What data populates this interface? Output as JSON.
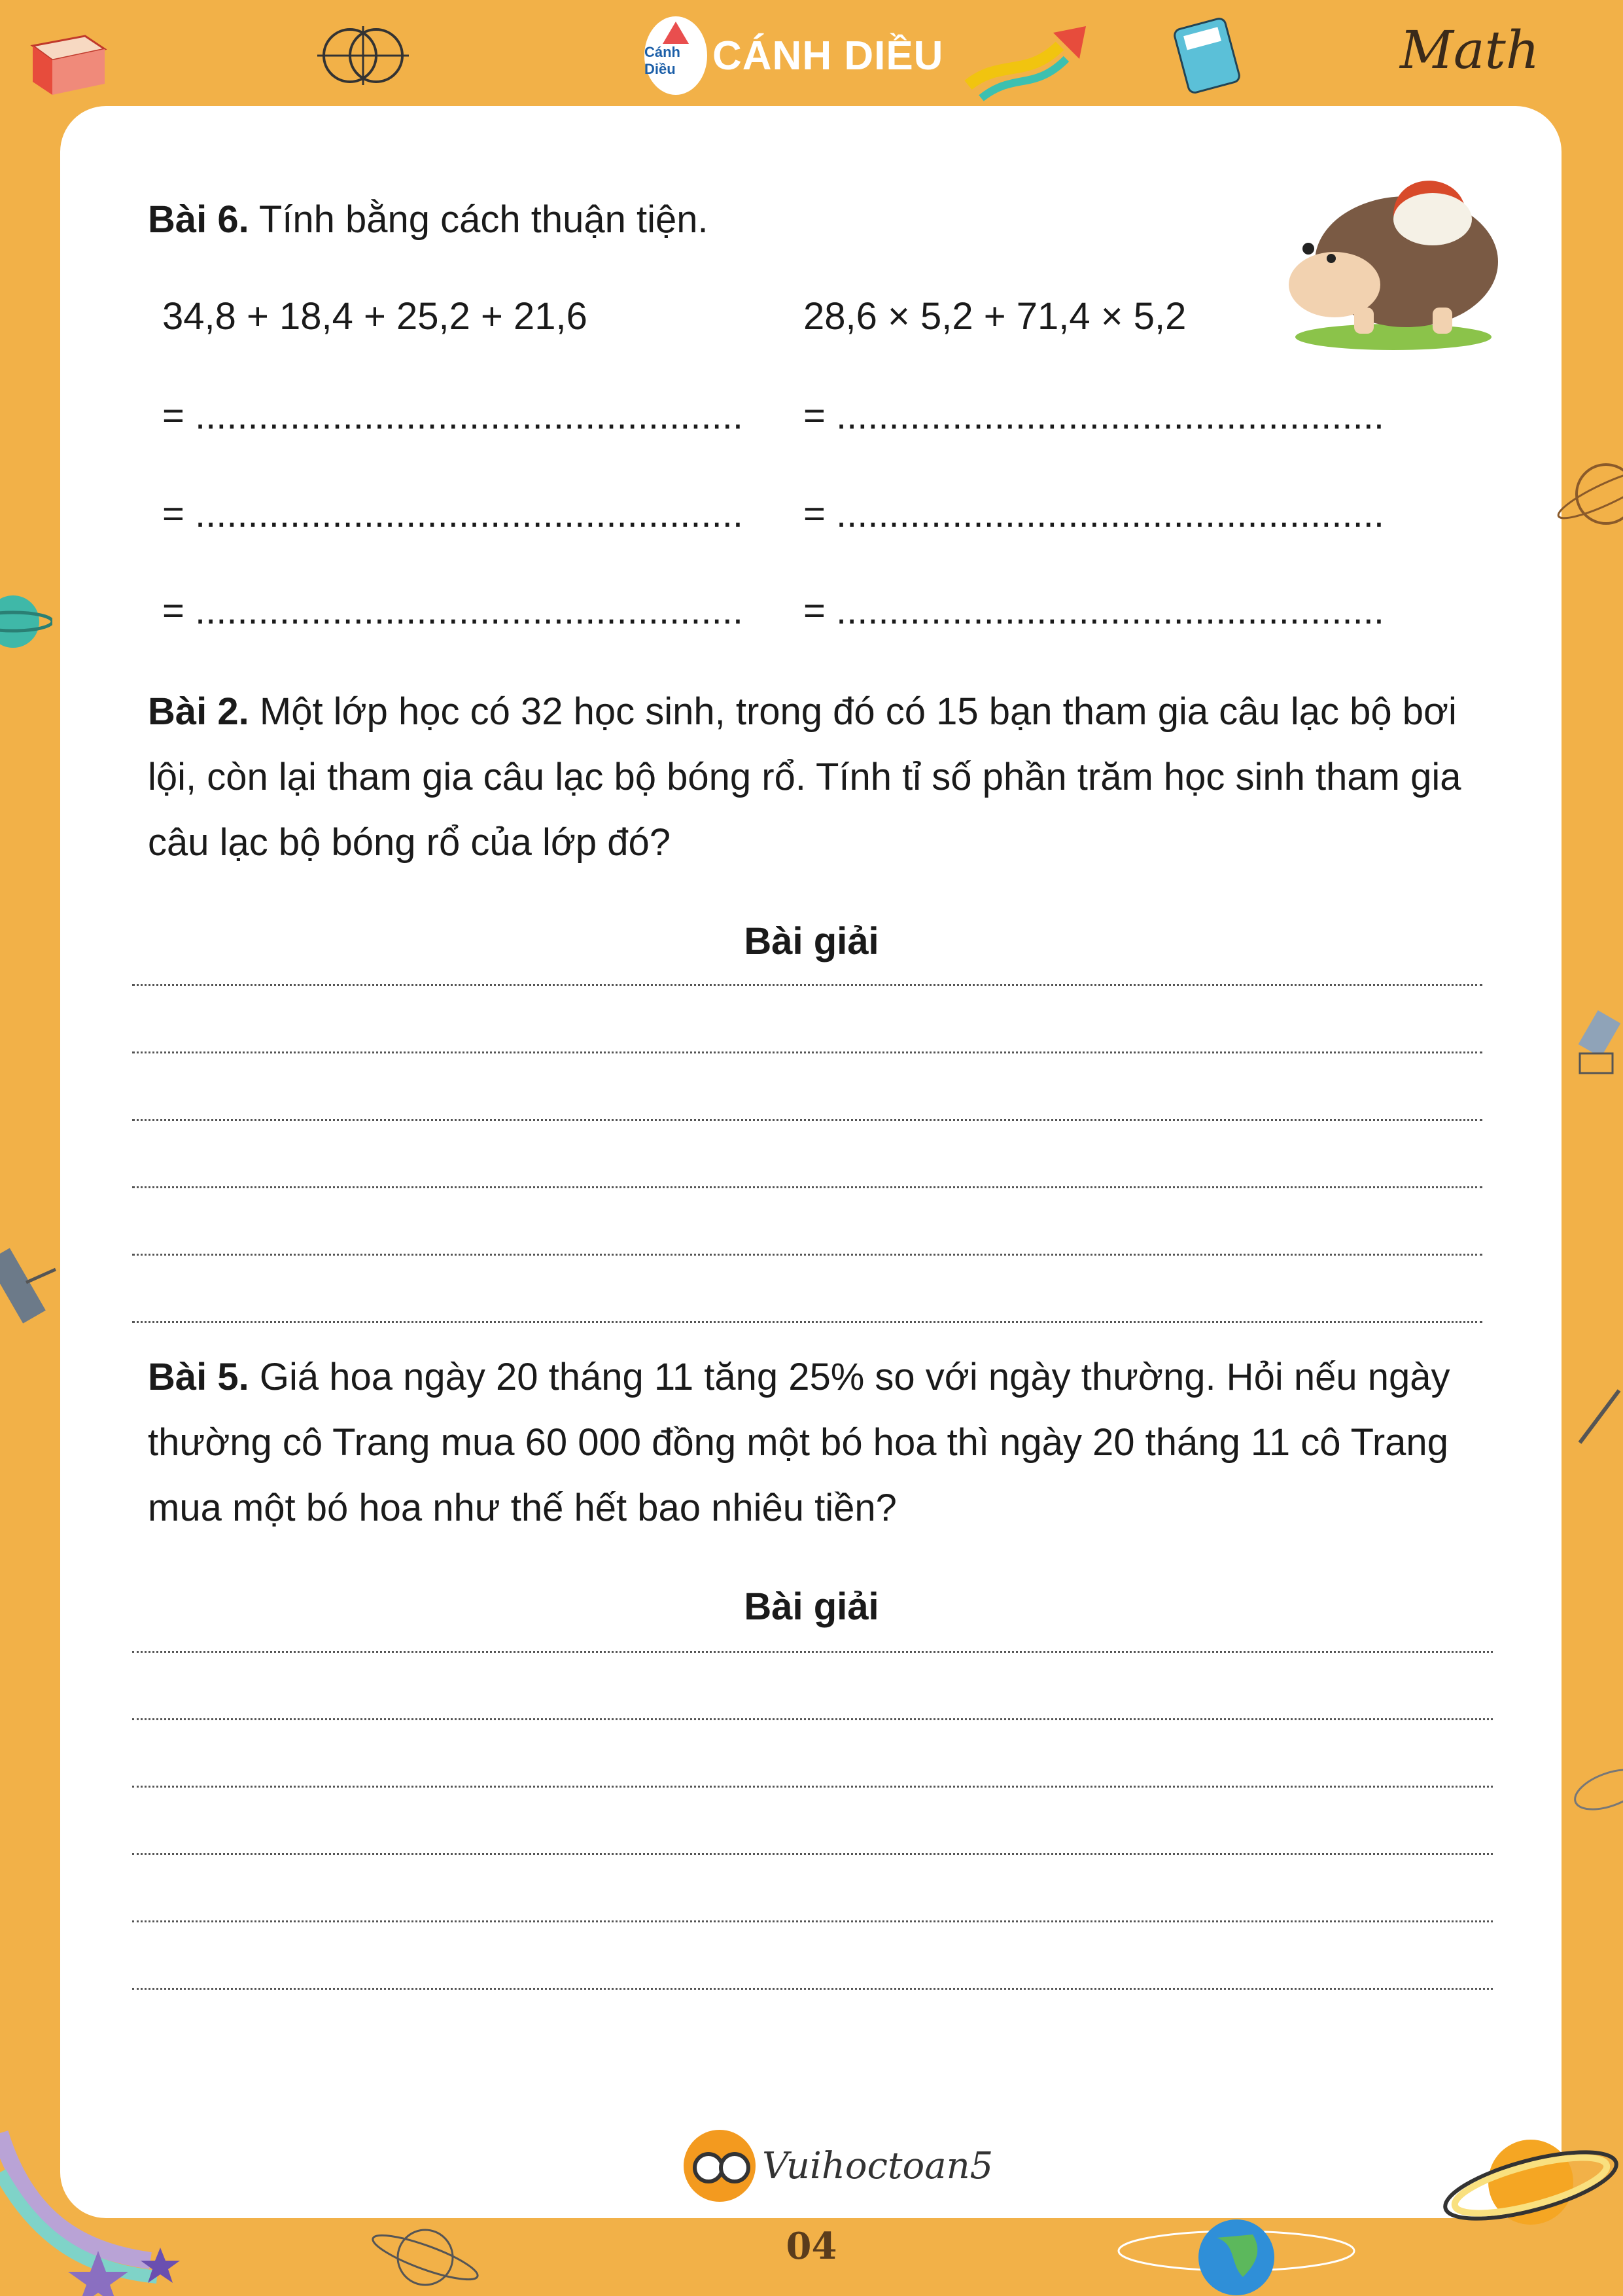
{
  "header": {
    "brand_logo_text": "Cánh Diều",
    "brand_name": "CÁNH DIỀU",
    "math_word": "Math"
  },
  "problems": {
    "p6": {
      "label": "Bài 6.",
      "text": "Tính bằng cách thuận tiện.",
      "expr_left": "34,8 + 18,4 + 25,2 + 21,6",
      "expr_right": "28,6 × 5,2 + 71,4 × 5,2",
      "blank_line": "= ...................................................."
    },
    "p2": {
      "label": "Bài 2.",
      "line1": "Một lớp học có 32 học sinh, trong đó có 15 bạn tham gia câu lạc bộ bơi",
      "line2": "lội, còn lại tham gia câu lạc bộ bóng rổ. Tính tỉ số phần trăm học sinh tham gia",
      "line3": "câu lạc bộ bóng rổ của lớp đó?",
      "solution_heading": "Bài giải"
    },
    "p5": {
      "label": "Bài 5.",
      "line1": "Giá hoa ngày 20 tháng 11 tăng 25% so với ngày thường. Hỏi nếu ngày",
      "line2": "thường cô Trang mua 60 000 đồng một bó hoa thì ngày 20 tháng 11 cô Trang",
      "line3": "mua một bó hoa như thế hết bao nhiêu tiền?",
      "solution_heading": "Bài giải"
    }
  },
  "footer": {
    "site_name": "Vuihoctoan5",
    "page_number": "04"
  },
  "colors": {
    "background": "#f2b148",
    "page": "#ffffff",
    "text": "#1a1a1a"
  }
}
